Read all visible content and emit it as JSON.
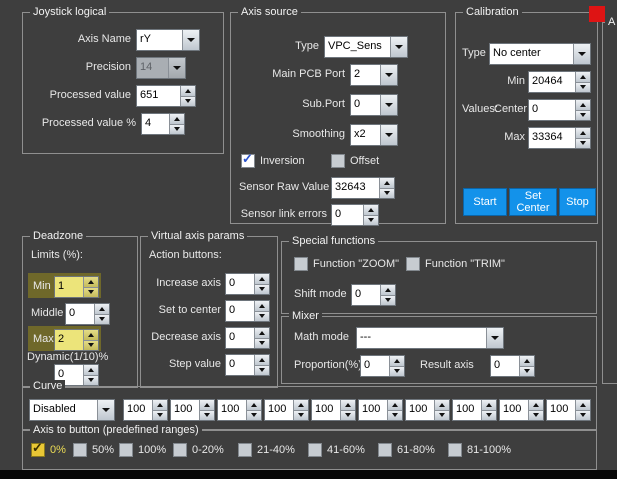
{
  "colors": {
    "panel_bg": "#3e3e3e",
    "accent_blue": "#1392ea",
    "highlight_olive": "#6f682a",
    "checked_yellow": "#e9c735",
    "indicator_red": "#de1414"
  },
  "joystick_logical": {
    "title": "Joystick logical",
    "axis_name": {
      "label": "Axis Name",
      "value": "rY"
    },
    "precision": {
      "label": "Precision",
      "value": "14"
    },
    "processed_value": {
      "label": "Processed value",
      "value": "651"
    },
    "processed_value_pct": {
      "label": "Processed value %",
      "value": "4"
    }
  },
  "axis_source": {
    "title": "Axis source",
    "type": {
      "label": "Type",
      "value": "VPC_Sens"
    },
    "main_pcb_port": {
      "label": "Main PCB Port",
      "value": "2"
    },
    "sub_port": {
      "label": "Sub.Port",
      "value": "0"
    },
    "smoothing": {
      "label": "Smoothing",
      "value": "x2"
    },
    "inversion": {
      "label": "Inversion",
      "checked": true
    },
    "offset": {
      "label": "Offset",
      "checked": false
    },
    "sensor_raw_value": {
      "label": "Sensor Raw Value",
      "value": "32643"
    },
    "sensor_link_errors": {
      "label": "Sensor link errors",
      "value": "0"
    }
  },
  "calibration": {
    "title": "Calibration",
    "type": {
      "label": "Type",
      "value": "No center"
    },
    "min": {
      "label": "Min",
      "value": "20464"
    },
    "values_label": "Values:",
    "center": {
      "label": "Center",
      "value": "0"
    },
    "max": {
      "label": "Max",
      "value": "33364"
    },
    "buttons": {
      "start": "Start",
      "set_center": "Set Center",
      "stop": "Stop"
    }
  },
  "deadzone": {
    "title": "Deadzone",
    "limits_label": "Limits (%):",
    "min": {
      "label": "Min",
      "value": "1",
      "highlighted": true
    },
    "middle": {
      "label": "Middle",
      "value": "0"
    },
    "max": {
      "label": "Max",
      "value": "2",
      "highlighted": true
    },
    "dynamic": {
      "label": "Dynamic(1/10)%",
      "value": "0"
    }
  },
  "virtual_axis_params": {
    "title": "Virtual axis params",
    "action_buttons_label": "Action buttons:",
    "increase_axis": {
      "label": "Increase axis",
      "value": "0"
    },
    "set_to_center": {
      "label": "Set to center",
      "value": "0"
    },
    "decrease_axis": {
      "label": "Decrease axis",
      "value": "0"
    },
    "step_value": {
      "label": "Step value",
      "value": "0"
    }
  },
  "special_functions": {
    "title": "Special functions",
    "function_zoom": {
      "label": "Function \"ZOOM\"",
      "checked": false
    },
    "function_trim": {
      "label": "Function \"TRIM\"",
      "checked": false
    },
    "shift_mode": {
      "label": "Shift mode",
      "value": "0"
    }
  },
  "mixer": {
    "title": "Mixer",
    "math_mode": {
      "label": "Math mode",
      "value": "---"
    },
    "proportion": {
      "label": "Proportion(%)",
      "value": "0"
    },
    "result_axis": {
      "label": "Result axis",
      "value": "0"
    }
  },
  "curve": {
    "title": "Curve",
    "mode": {
      "value": "Disabled"
    },
    "points": [
      "100",
      "100",
      "100",
      "100",
      "100",
      "100",
      "100",
      "100",
      "100",
      "100"
    ]
  },
  "axis_to_button": {
    "title": "Axis to button (predefined ranges)",
    "options": [
      {
        "label": "0%",
        "checked": true
      },
      {
        "label": "50%",
        "checked": false
      },
      {
        "label": "100%",
        "checked": false
      },
      {
        "label": "0-20%",
        "checked": false
      },
      {
        "label": "21-40%",
        "checked": false
      },
      {
        "label": "41-60%",
        "checked": false
      },
      {
        "label": "61-80%",
        "checked": false
      },
      {
        "label": "81-100%",
        "checked": false
      }
    ]
  },
  "right_panel": {
    "partial_group_title": "A"
  }
}
